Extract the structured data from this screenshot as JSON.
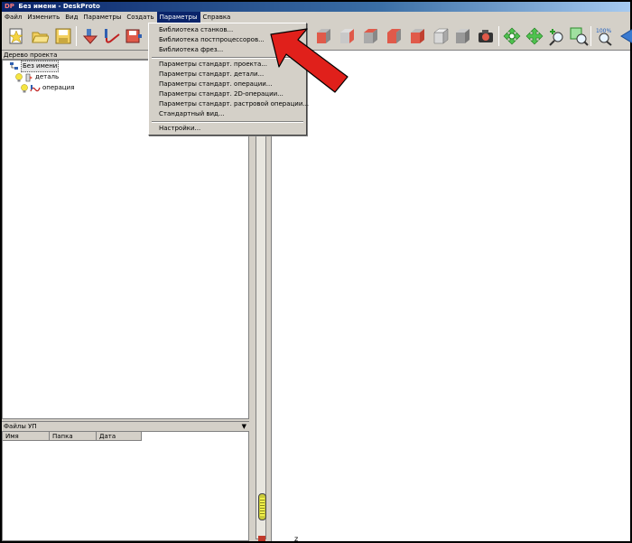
{
  "window": {
    "logo": "DP",
    "title": "Без имени - DeskProto"
  },
  "menubar": [
    "Файл",
    "Изменить",
    "Вид",
    "Параметры",
    "Создать",
    "Параметры",
    "Справка"
  ],
  "params_menu": {
    "items": [
      "Библиотека станков...",
      "Библиотека постпроцессоров...",
      "Библиотека фрез...",
      "Параметры стандарт. проекта...",
      "Параметры стандарт. детали...",
      "Параметры стандарт. операции...",
      "Параметры стандарт. 2D-операции...",
      "Параметры стандарт. растровой операции...",
      "Стандартный вид...",
      "Настройки..."
    ]
  },
  "project_tree": {
    "header": "Дерево проекта",
    "root": "Без имени",
    "part": "деталь",
    "operation": "операция"
  },
  "files_panel": {
    "header": "Файлы УП",
    "columns": [
      "Имя",
      "Папка",
      "Дата"
    ]
  },
  "viewport": {
    "axis_label": "z"
  },
  "colors": {
    "menu_highlight": "#0a246a",
    "arrow": "#e0201b",
    "face_red": "#e05a4a"
  }
}
